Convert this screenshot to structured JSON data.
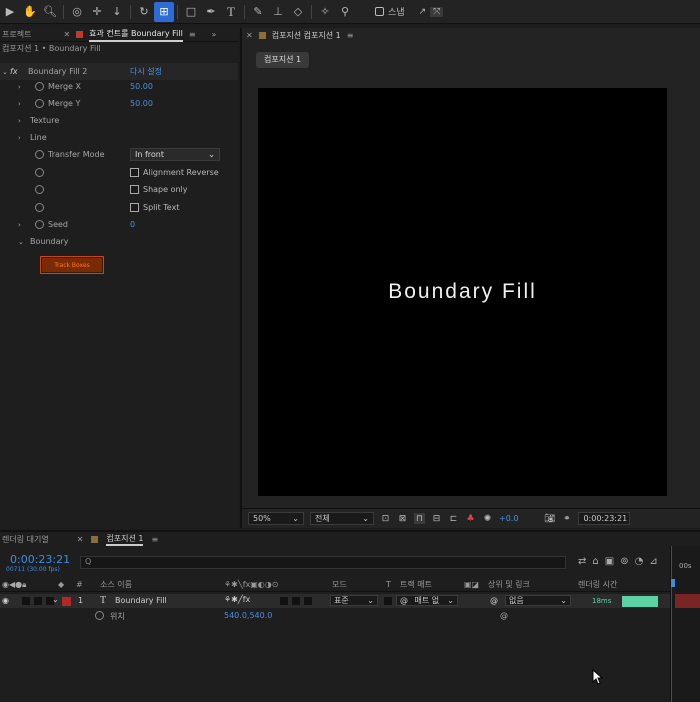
{
  "toolbar": {
    "snap_label": "스냅"
  },
  "left_panel": {
    "tab_project": "프로젝트",
    "tab_effects": "효과 컨트롤 Boundary Fill",
    "breadcrumb": "컴포지션 1 • Boundary Fill",
    "effect_name": "Boundary Fill 2",
    "effect_reset": "다시 설정",
    "merge_x_label": "Merge X",
    "merge_x_value": "50.00",
    "merge_y_label": "Merge Y",
    "merge_y_value": "50.00",
    "texture_label": "Texture",
    "line_label": "Line",
    "transfer_mode_label": "Transfer Mode",
    "transfer_mode_value": "In front",
    "alignment_reverse": "Alignment Reverse",
    "shape_only": "Shape only",
    "split_text": "Split Text",
    "seed_label": "Seed",
    "seed_value": "0",
    "boundary_label": "Boundary",
    "track_button": "Track Boxes"
  },
  "comp_panel": {
    "tab_label": "컴포지션 컴포지션 1",
    "comp_pill": "컴포지션 1",
    "viewer_text": "Boundary Fill",
    "zoom": "50%",
    "resolution": "전체",
    "exposure": "+0.0",
    "timecode": "0:00:23:21"
  },
  "timeline": {
    "tab_render": "렌더링 대기열",
    "tab_comp": "컴포지션 1",
    "timecode": "0:00:23:21",
    "frame_info": "00711 (30.00 fps)",
    "search_placeholder": "Q",
    "col_source": "소스 이름",
    "col_mode": "모드",
    "col_t": "T",
    "col_trackmatte": "트랙 매트",
    "col_parent": "상위 및 링크",
    "col_render_time": "렌더링 시간",
    "layer_number": "1",
    "layer_name": "Boundary Fill",
    "layer_mode": "표준",
    "layer_matte": "매트 없",
    "layer_parent": "없음",
    "layer_render_time": "18ms",
    "prop_name": "위치",
    "prop_value": "540.0,540.0",
    "ruler_label": "00s"
  },
  "colors": {
    "accent": "#2d6cd6",
    "value_blue": "#4d8fe0",
    "render_bar": "#5bd1a4",
    "track_button_border": "#c24a10"
  }
}
